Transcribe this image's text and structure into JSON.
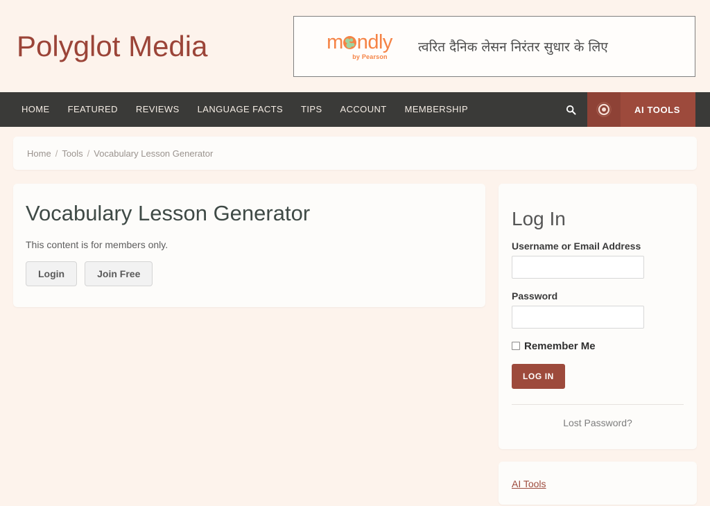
{
  "site": {
    "title": "Polyglot Media",
    "title_color": "#9b4438",
    "page_background": "#fdf3ec"
  },
  "ad": {
    "brand_part1": "m",
    "brand_globe": "o",
    "brand_part2": "ndly",
    "byline": "by Pearson",
    "tagline": "त्वरित दैनिक लेसन निरंतर सुधार के लिए",
    "brand_color": "#f58345"
  },
  "nav": {
    "items": [
      {
        "label": "HOME"
      },
      {
        "label": "FEATURED"
      },
      {
        "label": "REVIEWS"
      },
      {
        "label": "LANGUAGE FACTS"
      },
      {
        "label": "TIPS"
      },
      {
        "label": "ACCOUNT"
      },
      {
        "label": "MEMBERSHIP"
      }
    ],
    "search_icon": "search-icon",
    "badge_icon": "target-ring-icon",
    "ai_tools_label": "AI TOOLS",
    "bar_color": "#3a3a38",
    "accent_color": "#9d4a3c"
  },
  "breadcrumb": {
    "items": [
      {
        "label": "Home"
      },
      {
        "label": "Tools"
      },
      {
        "label": "Vocabulary Lesson Generator"
      }
    ],
    "separator": "/"
  },
  "main": {
    "title": "Vocabulary Lesson Generator",
    "note": "This content is for members only.",
    "login_button": "Login",
    "join_button": "Join Free"
  },
  "login_widget": {
    "title": "Log In",
    "username_label": "Username or Email Address",
    "username_value": "",
    "username_placeholder": "",
    "password_label": "Password",
    "password_value": "",
    "password_placeholder": "",
    "remember_label": "Remember Me",
    "remember_checked": false,
    "submit_label": "LOG IN",
    "lost_password_label": "Lost Password?"
  },
  "aitools_widget": {
    "link_label": "AI Tools"
  }
}
